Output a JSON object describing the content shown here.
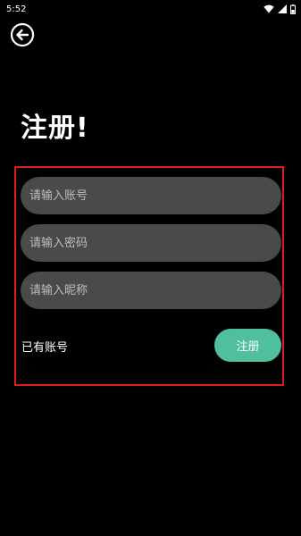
{
  "status_bar": {
    "time": "5:52",
    "icons": [
      "wifi-icon",
      "signal-icon",
      "battery-icon"
    ]
  },
  "header": {
    "back_icon": "back-arrow-circle-icon",
    "title": "注册!"
  },
  "form": {
    "frame_color": "#e01b1b",
    "account": {
      "value": "",
      "placeholder": "请输入账号"
    },
    "password": {
      "value": "",
      "placeholder": "请输入密码"
    },
    "nickname": {
      "value": "",
      "placeholder": "请输入昵称"
    },
    "has_account_link": "已有账号",
    "register_label": "注册",
    "register_color": "#4fbf9f",
    "field_color": "#4a4a4a"
  }
}
